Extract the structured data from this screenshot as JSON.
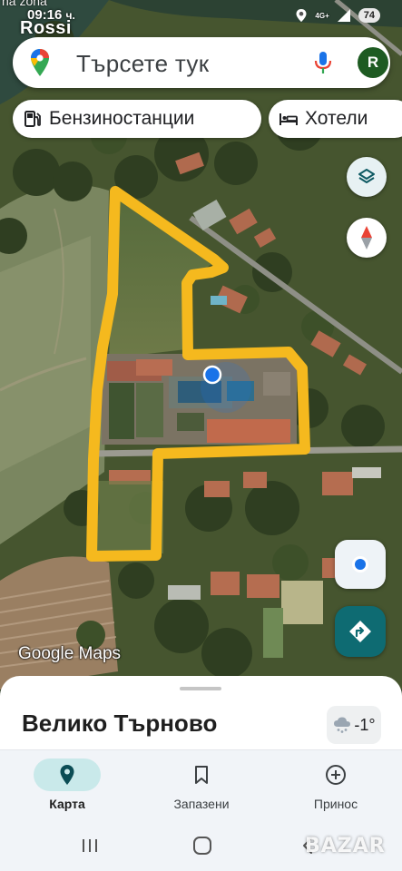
{
  "status_bar": {
    "clipped_top_text": "na zona",
    "time": "09:16",
    "time_suffix": "ч.",
    "overlay_name": "Rossi",
    "network": "4G+",
    "battery": "74"
  },
  "search": {
    "placeholder": "Търсете тук",
    "avatar_letter": "R"
  },
  "chips": [
    {
      "label": "Бензиностанции",
      "icon": "gas-station-icon"
    },
    {
      "label": "Хотели",
      "icon": "hotel-bed-icon"
    }
  ],
  "map": {
    "watermark": "Google Maps",
    "boundary_color": "#F5B91E",
    "location_dot_color": "#1A73E8"
  },
  "sheet": {
    "place_name": "Велико Търново",
    "weather_temp": "-1°",
    "weather_icon": "cloud-snow-icon"
  },
  "bottom_nav": [
    {
      "label": "Карта",
      "icon": "map-pin-icon",
      "active": true
    },
    {
      "label": "Запазени",
      "icon": "bookmark-icon",
      "active": false
    },
    {
      "label": "Принос",
      "icon": "add-circle-icon",
      "active": false
    }
  ],
  "image_mark": "BAZAR"
}
